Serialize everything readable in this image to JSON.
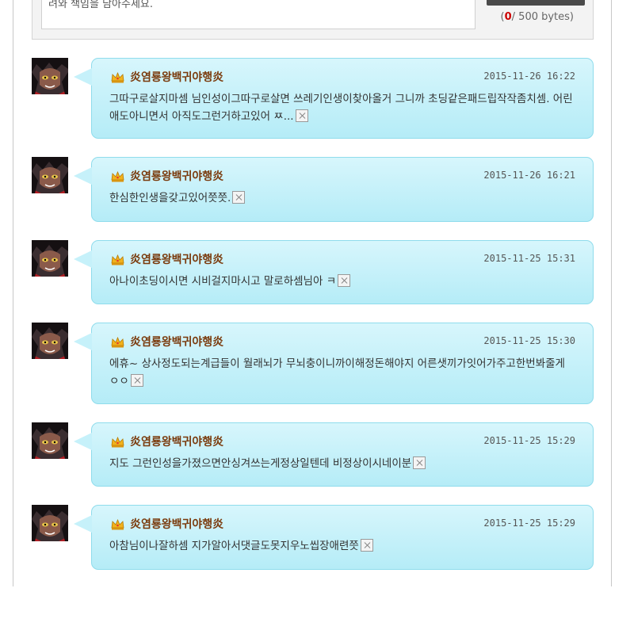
{
  "editor": {
    "text": "려와 책임을 담아주세요.",
    "count": "0",
    "limit": "/ 500 bytes)",
    "open_paren": "("
  },
  "comments": [
    {
      "nick": "炎염룡왕백귀야행炎",
      "date": "2015-11-26 16:22",
      "text": "그따구로살지마셈 님인성이그따구로살면 쓰레기인생이찾아올거 그니까 초딩같은패드립작작좀치셈. 어린애도아니면서 아직도그런거하고있어 ㅉ..."
    },
    {
      "nick": "炎염룡왕백귀야행炎",
      "date": "2015-11-26 16:21",
      "text": "한심한인생을갖고있어쯧쯧."
    },
    {
      "nick": "炎염룡왕백귀야행炎",
      "date": "2015-11-25 15:31",
      "text": "아나이초딩이시면 시비걸지마시고 말로하셈님아 ㅋ"
    },
    {
      "nick": "炎염룡왕백귀야행炎",
      "date": "2015-11-25 15:30",
      "text": "에휴~ 상사정도되는계급들이 월래뇌가 무뇌충이니까이해정돈해야지 어른샛끼가잇어가주고한번봐줄게 ㅇㅇ"
    },
    {
      "nick": "炎염룡왕백귀야행炎",
      "date": "2015-11-25 15:29",
      "text": "지도 그런인성을가졌으면안싱겨쓰는게정상일텐데 비정상이시네이분"
    },
    {
      "nick": "炎염룡왕백귀야행炎",
      "date": "2015-11-25 15:29",
      "text": "아참님이나잘하셈 지가알아서댓글도못지우노씹장애련쯧"
    }
  ]
}
